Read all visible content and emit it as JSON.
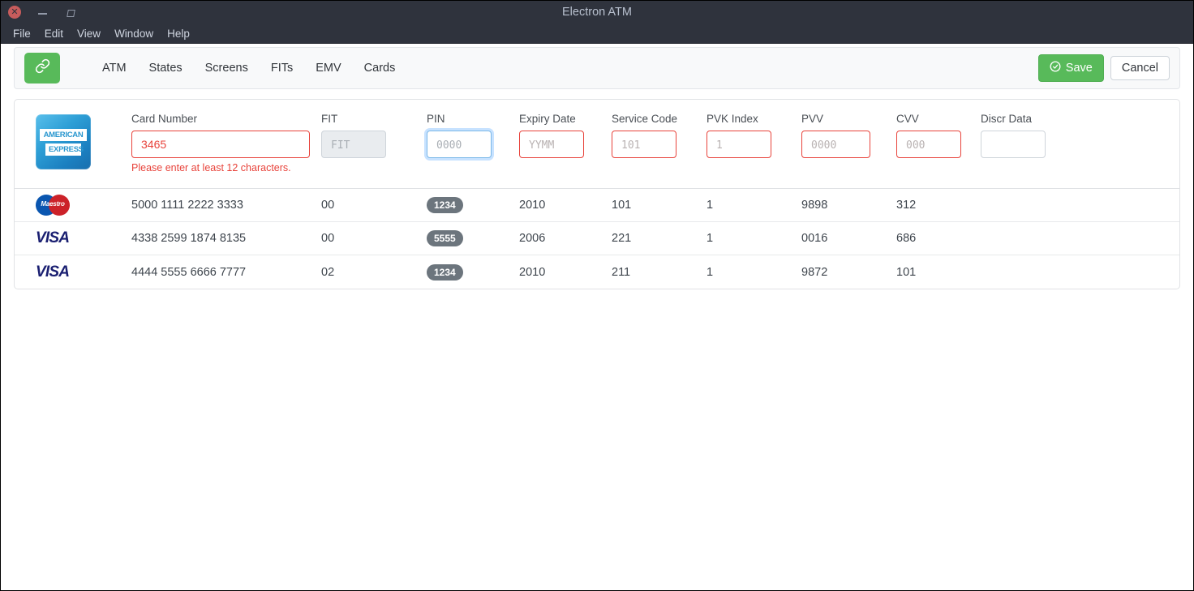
{
  "window": {
    "title": "Electron ATM",
    "controls": {
      "close": "close-window",
      "minimize": "minimize-window",
      "maximize": "maximize-window"
    }
  },
  "menubar": {
    "items": [
      "File",
      "Edit",
      "View",
      "Window",
      "Help"
    ]
  },
  "toolbar": {
    "link_button_icon": "link-icon",
    "nav": [
      "ATM",
      "States",
      "Screens",
      "FITs",
      "EMV",
      "Cards"
    ],
    "save_label": "Save",
    "save_icon": "check-circle-icon",
    "cancel_label": "Cancel"
  },
  "form": {
    "brand": "american-express",
    "brand_line1": "AMERICAN",
    "brand_line2": "EXPRESS",
    "fields": [
      {
        "key": "card_number",
        "label": "Card Number",
        "value": "3465",
        "placeholder": "",
        "state": "invalid",
        "error": "Please enter at least 12 characters."
      },
      {
        "key": "fit",
        "label": "FIT",
        "value": "",
        "placeholder": "FIT",
        "state": "disabled",
        "error": ""
      },
      {
        "key": "pin",
        "label": "PIN",
        "value": "",
        "placeholder": "0000",
        "state": "focused",
        "error": ""
      },
      {
        "key": "expiry_date",
        "label": "Expiry Date",
        "value": "",
        "placeholder": "YYMM",
        "state": "invalid",
        "error": ""
      },
      {
        "key": "service_code",
        "label": "Service Code",
        "value": "",
        "placeholder": "101",
        "state": "invalid",
        "error": ""
      },
      {
        "key": "pvk_index",
        "label": "PVK Index",
        "value": "",
        "placeholder": "1",
        "state": "invalid",
        "error": ""
      },
      {
        "key": "pvv",
        "label": "PVV",
        "value": "",
        "placeholder": "0000",
        "state": "invalid",
        "error": ""
      },
      {
        "key": "cvv",
        "label": "CVV",
        "value": "",
        "placeholder": "000",
        "state": "invalid",
        "error": ""
      },
      {
        "key": "discr_data",
        "label": "Discr Data",
        "value": "",
        "placeholder": "",
        "state": "normal",
        "error": ""
      }
    ],
    "labels": {
      "card_number": "Card Number",
      "fit": "FIT",
      "pin": "PIN",
      "expiry_date": "Expiry Date",
      "service_code": "Service Code",
      "pvk_index": "PVK Index",
      "pvv": "PVV",
      "cvv": "CVV",
      "discr_data": "Discr Data"
    },
    "values": {
      "card_number": "3465"
    },
    "placeholders": {
      "fit": "FIT",
      "pin": "0000",
      "expiry_date": "YYMM",
      "service_code": "101",
      "pvk_index": "1",
      "pvv": "0000",
      "cvv": "000",
      "discr_data": ""
    },
    "error_card_number": "Please enter at least 12 characters."
  },
  "cards": [
    {
      "brand": "maestro",
      "brand_text": "Maestro",
      "card_number": "5000 1111 2222 3333",
      "fit": "00",
      "pin": "1234",
      "expiry_date": "2010",
      "service_code": "101",
      "pvk_index": "1",
      "pvv": "9898",
      "cvv": "312",
      "discr_data": ""
    },
    {
      "brand": "visa",
      "brand_text": "VISA",
      "card_number": "4338 2599 1874 8135",
      "fit": "00",
      "pin": "5555",
      "expiry_date": "2006",
      "service_code": "221",
      "pvk_index": "1",
      "pvv": "0016",
      "cvv": "686",
      "discr_data": ""
    },
    {
      "brand": "visa",
      "brand_text": "VISA",
      "card_number": "4444 5555 6666 7777",
      "fit": "02",
      "pin": "1234",
      "expiry_date": "2010",
      "service_code": "211",
      "pvk_index": "1",
      "pvv": "9872",
      "cvv": "101",
      "discr_data": ""
    }
  ],
  "colors": {
    "titlebar_bg": "#2f333d",
    "accent_green": "#58ba5a",
    "error_red": "#e8433b",
    "focus_blue": "#7bb8e8",
    "badge_gray": "#6c757d",
    "visa_blue": "#1a1f71",
    "maestro_blue": "#0a56b0",
    "maestro_red": "#cc2229"
  }
}
